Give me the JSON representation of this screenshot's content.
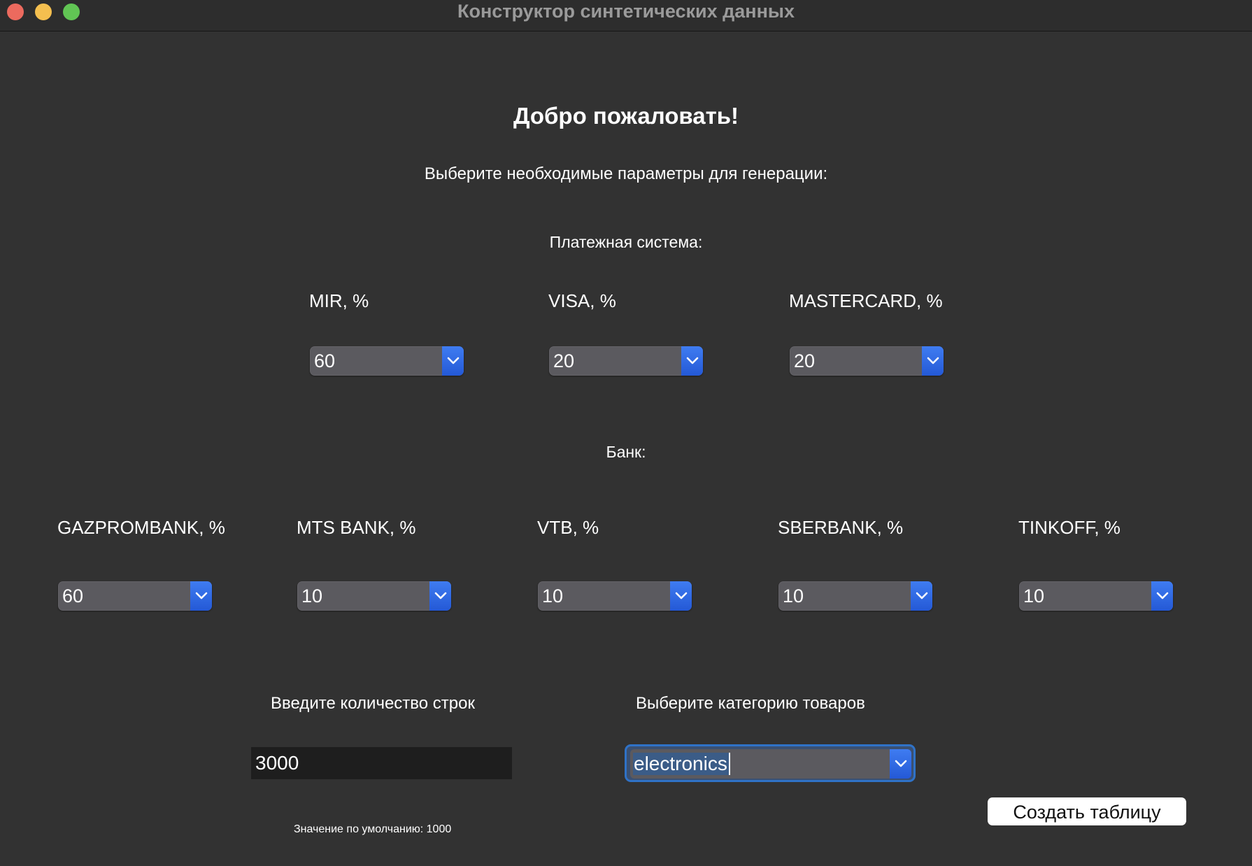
{
  "window": {
    "title": "Конструктор синтетических данных"
  },
  "welcome": "Добро пожаловать!",
  "subtitle": "Выберите необходимые параметры для генерации:",
  "payment": {
    "section_label": "Платежная система:",
    "fields": [
      {
        "label": "MIR, %",
        "value": "60"
      },
      {
        "label": "VISA, %",
        "value": "20"
      },
      {
        "label": "MASTERCARD, %",
        "value": "20"
      }
    ]
  },
  "bank": {
    "section_label": "Банк:",
    "fields": [
      {
        "label": "GAZPROMBANK, %",
        "value": "60"
      },
      {
        "label": "MTS BANK, %",
        "value": "10"
      },
      {
        "label": "VTB, %",
        "value": "10"
      },
      {
        "label": "SBERBANK, %",
        "value": "10"
      },
      {
        "label": "TINKOFF, %",
        "value": "10"
      }
    ]
  },
  "rows": {
    "label": "Введите количество строк",
    "value": "3000",
    "hint": "Значение по умолчанию: 1000"
  },
  "category": {
    "label": "Выберите категорию товаров",
    "value": "electronics"
  },
  "create_button": "Создать таблицу",
  "colors": {
    "background": "#323232",
    "accent": "#2f6fe4",
    "focus_ring": "#2f72c7"
  },
  "icons": {
    "dropdown": "chevron-down-icon"
  }
}
